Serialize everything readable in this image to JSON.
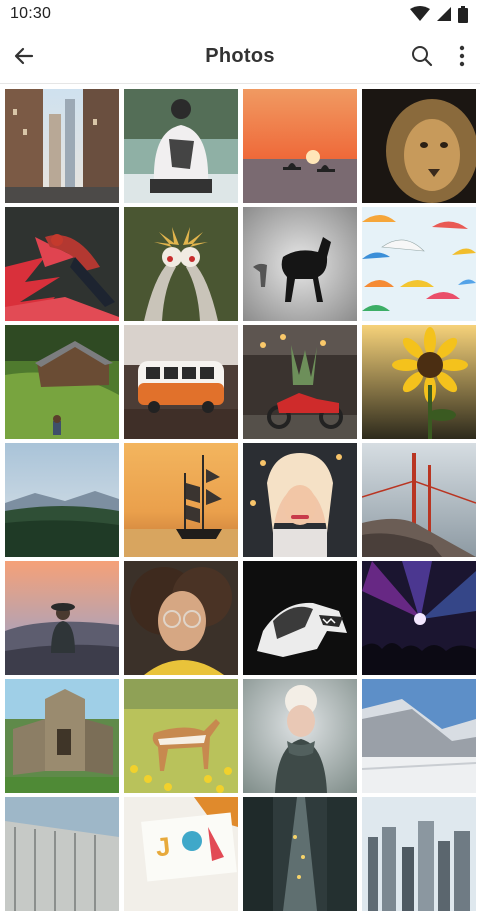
{
  "status": {
    "time": "10:30"
  },
  "appbar": {
    "title": "Photos"
  },
  "icons": {
    "back": "arrow-left-icon",
    "search": "search-icon",
    "more": "more-vert-icon",
    "wifi": "wifi-icon",
    "signal": "signal-icon",
    "battery": "battery-icon"
  },
  "colors": {
    "text": "#333333",
    "divider": "#e6e6e6"
  }
}
